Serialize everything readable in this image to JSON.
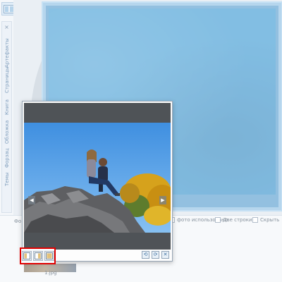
{
  "sidebar": {
    "close": "×",
    "tabs": [
      "Артефакты",
      "Страницы",
      "Книга",
      "Обложка",
      "Форзац",
      "Темы"
    ]
  },
  "bottom": {
    "left_label": "Фо",
    "opt_used": "фото использовано",
    "opt_double": "Две строки",
    "opt_hide": "Скрыть",
    "thumb_name": "1.jpg"
  },
  "preview": {
    "prev": "◀",
    "next": "▶",
    "actions": [
      "⟲",
      "⟳",
      "✕"
    ]
  },
  "colors": {
    "highlight": "#e00000",
    "page_blue": "#3f9bd4",
    "sky": "#4c9ae4"
  }
}
